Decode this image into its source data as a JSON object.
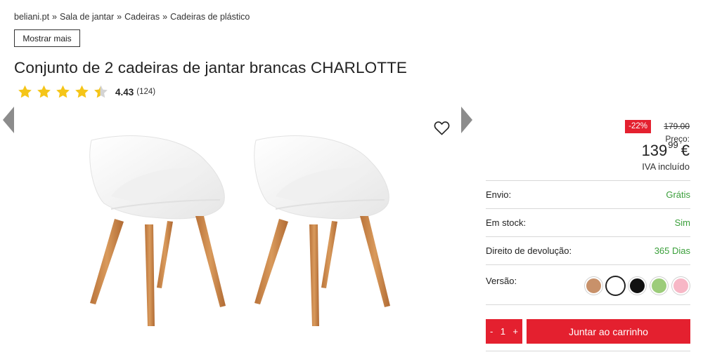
{
  "breadcrumb": {
    "items": [
      "beliani.pt",
      "Sala de jantar",
      "Cadeiras",
      "Cadeiras de plástico"
    ],
    "separator": "»"
  },
  "show_more_label": "Mostrar mais",
  "product": {
    "title": "Conjunto de 2 cadeiras de jantar brancas CHARLOTTE",
    "rating": {
      "score": "4.43",
      "count": "(124)",
      "stars_value": 4.43,
      "star_color": "#f5c518"
    }
  },
  "gallery": {
    "icons": [
      "arrow-left-icon",
      "arrow-right-icon",
      "heart-icon"
    ]
  },
  "pricing": {
    "discount": "-22%",
    "old_price": "179.00",
    "price_label": "Preço:",
    "price_main": "139",
    "price_cents": "99",
    "currency": "€",
    "vat": "IVA incluído"
  },
  "details": [
    {
      "label": "Envio:",
      "value": "Grátis"
    },
    {
      "label": "Em stock:",
      "value": "Sim"
    },
    {
      "label": "Direito de devolução:",
      "value": "365 Dias"
    }
  ],
  "version": {
    "label": "Versão:",
    "swatches": [
      "#c8916a",
      "#ffffff",
      "#111111",
      "#9ccc7a",
      "#f7b7c6"
    ],
    "selected_index": 1
  },
  "cart": {
    "minus": "-",
    "quantity": "1",
    "plus": "+",
    "add_label": "Juntar ao carrinho"
  },
  "colors": {
    "accent": "#e4202f",
    "green": "#3a9f3a"
  }
}
